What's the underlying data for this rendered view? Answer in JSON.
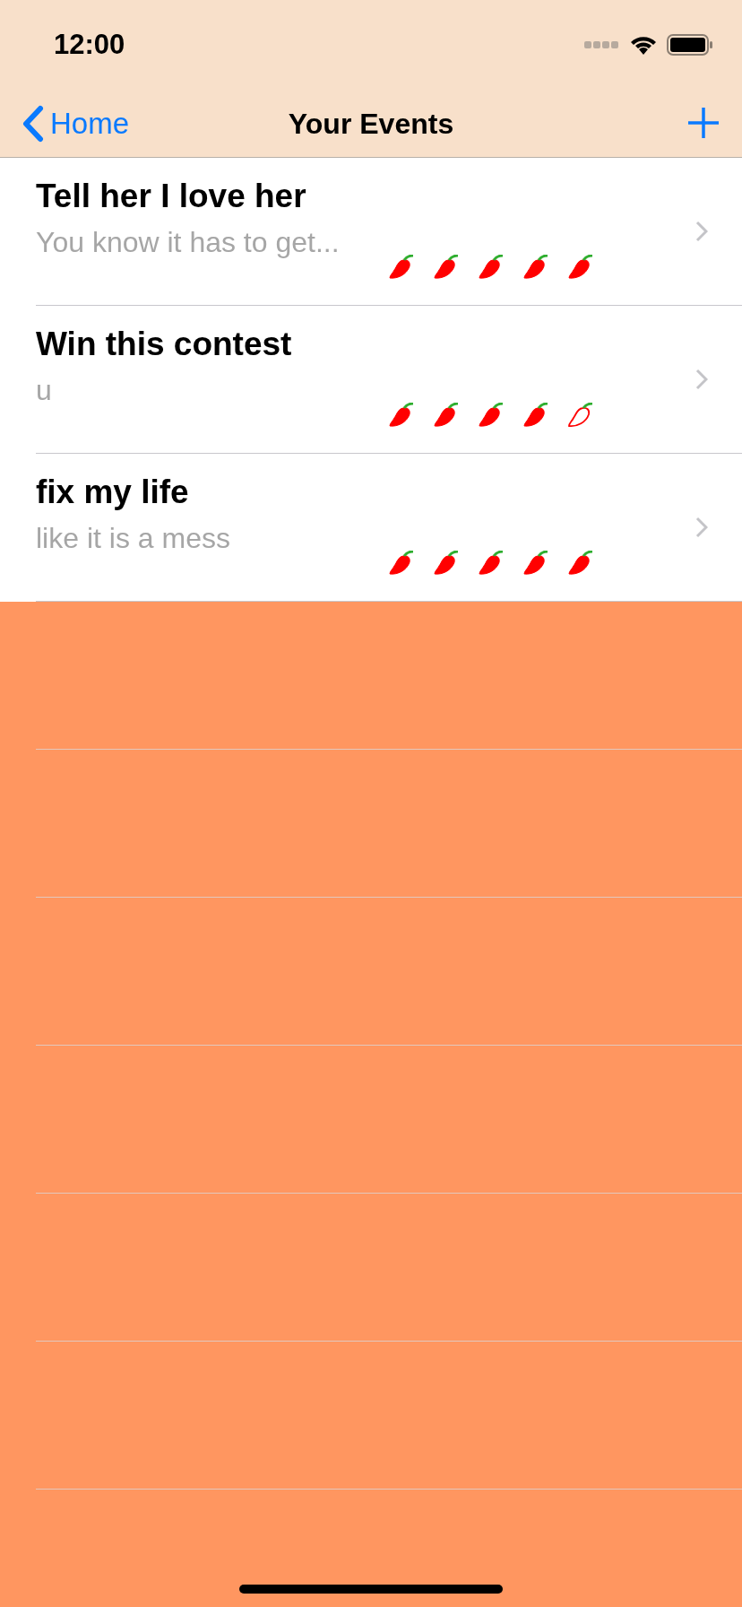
{
  "status_bar": {
    "time": "12:00"
  },
  "nav_bar": {
    "back": "Home",
    "title": "Your Events"
  },
  "events": [
    {
      "title": "Tell her I love her",
      "subtitle": "You know it has to get...",
      "stars": 5
    },
    {
      "title": "Win this contest",
      "subtitle": "u",
      "stars": 4
    },
    {
      "title": "fix my life",
      "subtitle": "like it is a mess",
      "stars": 5
    }
  ]
}
